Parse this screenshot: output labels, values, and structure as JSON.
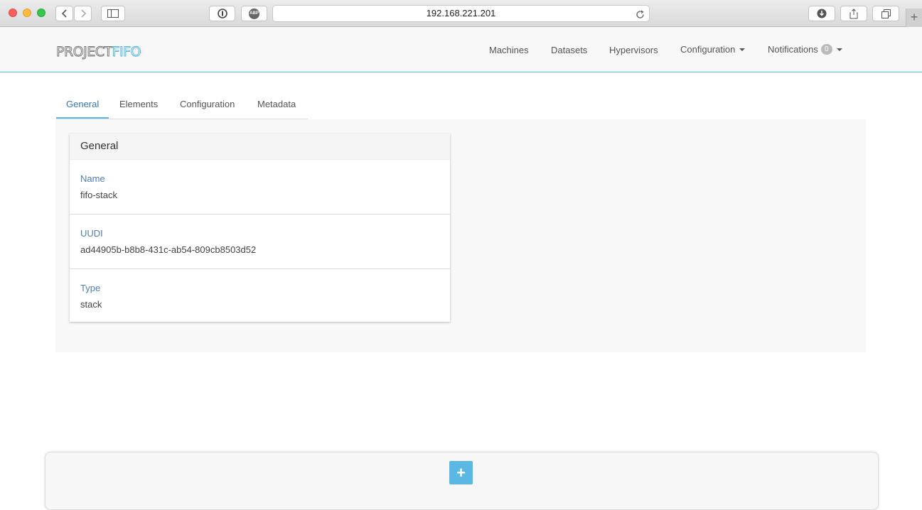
{
  "browser": {
    "url": "192.168.221.201",
    "new_tab": "+",
    "icons": [
      "back-icon",
      "forward-icon",
      "sidebar-icon",
      "password-icon",
      "adblock-icon",
      "reload-icon",
      "download-icon",
      "share-icon",
      "tabs-icon"
    ],
    "adblock_label": "ABP"
  },
  "header": {
    "logo_part1": "PROJECT",
    "logo_part2": "FIFO",
    "nav": {
      "machines": "Machines",
      "datasets": "Datasets",
      "hypervisors": "Hypervisors",
      "configuration": "Configuration",
      "notifications": "Notifications",
      "notifications_count": "0"
    }
  },
  "tabs": {
    "general": "General",
    "elements": "Elements",
    "configuration": "Configuration",
    "metadata": "Metadata",
    "active": "General"
  },
  "card": {
    "title": "General",
    "fields": [
      {
        "label": "Name",
        "value": "fifo-stack"
      },
      {
        "label": "UUDI",
        "value": "ad44905b-b8b8-431c-ab54-809cb8503d52"
      },
      {
        "label": "Type",
        "value": "stack"
      }
    ]
  },
  "bottom": {
    "add_label": "+"
  },
  "colors": {
    "accent": "#5bb7e4",
    "label_blue": "#4f7db7",
    "link_active": "#337ab7"
  }
}
